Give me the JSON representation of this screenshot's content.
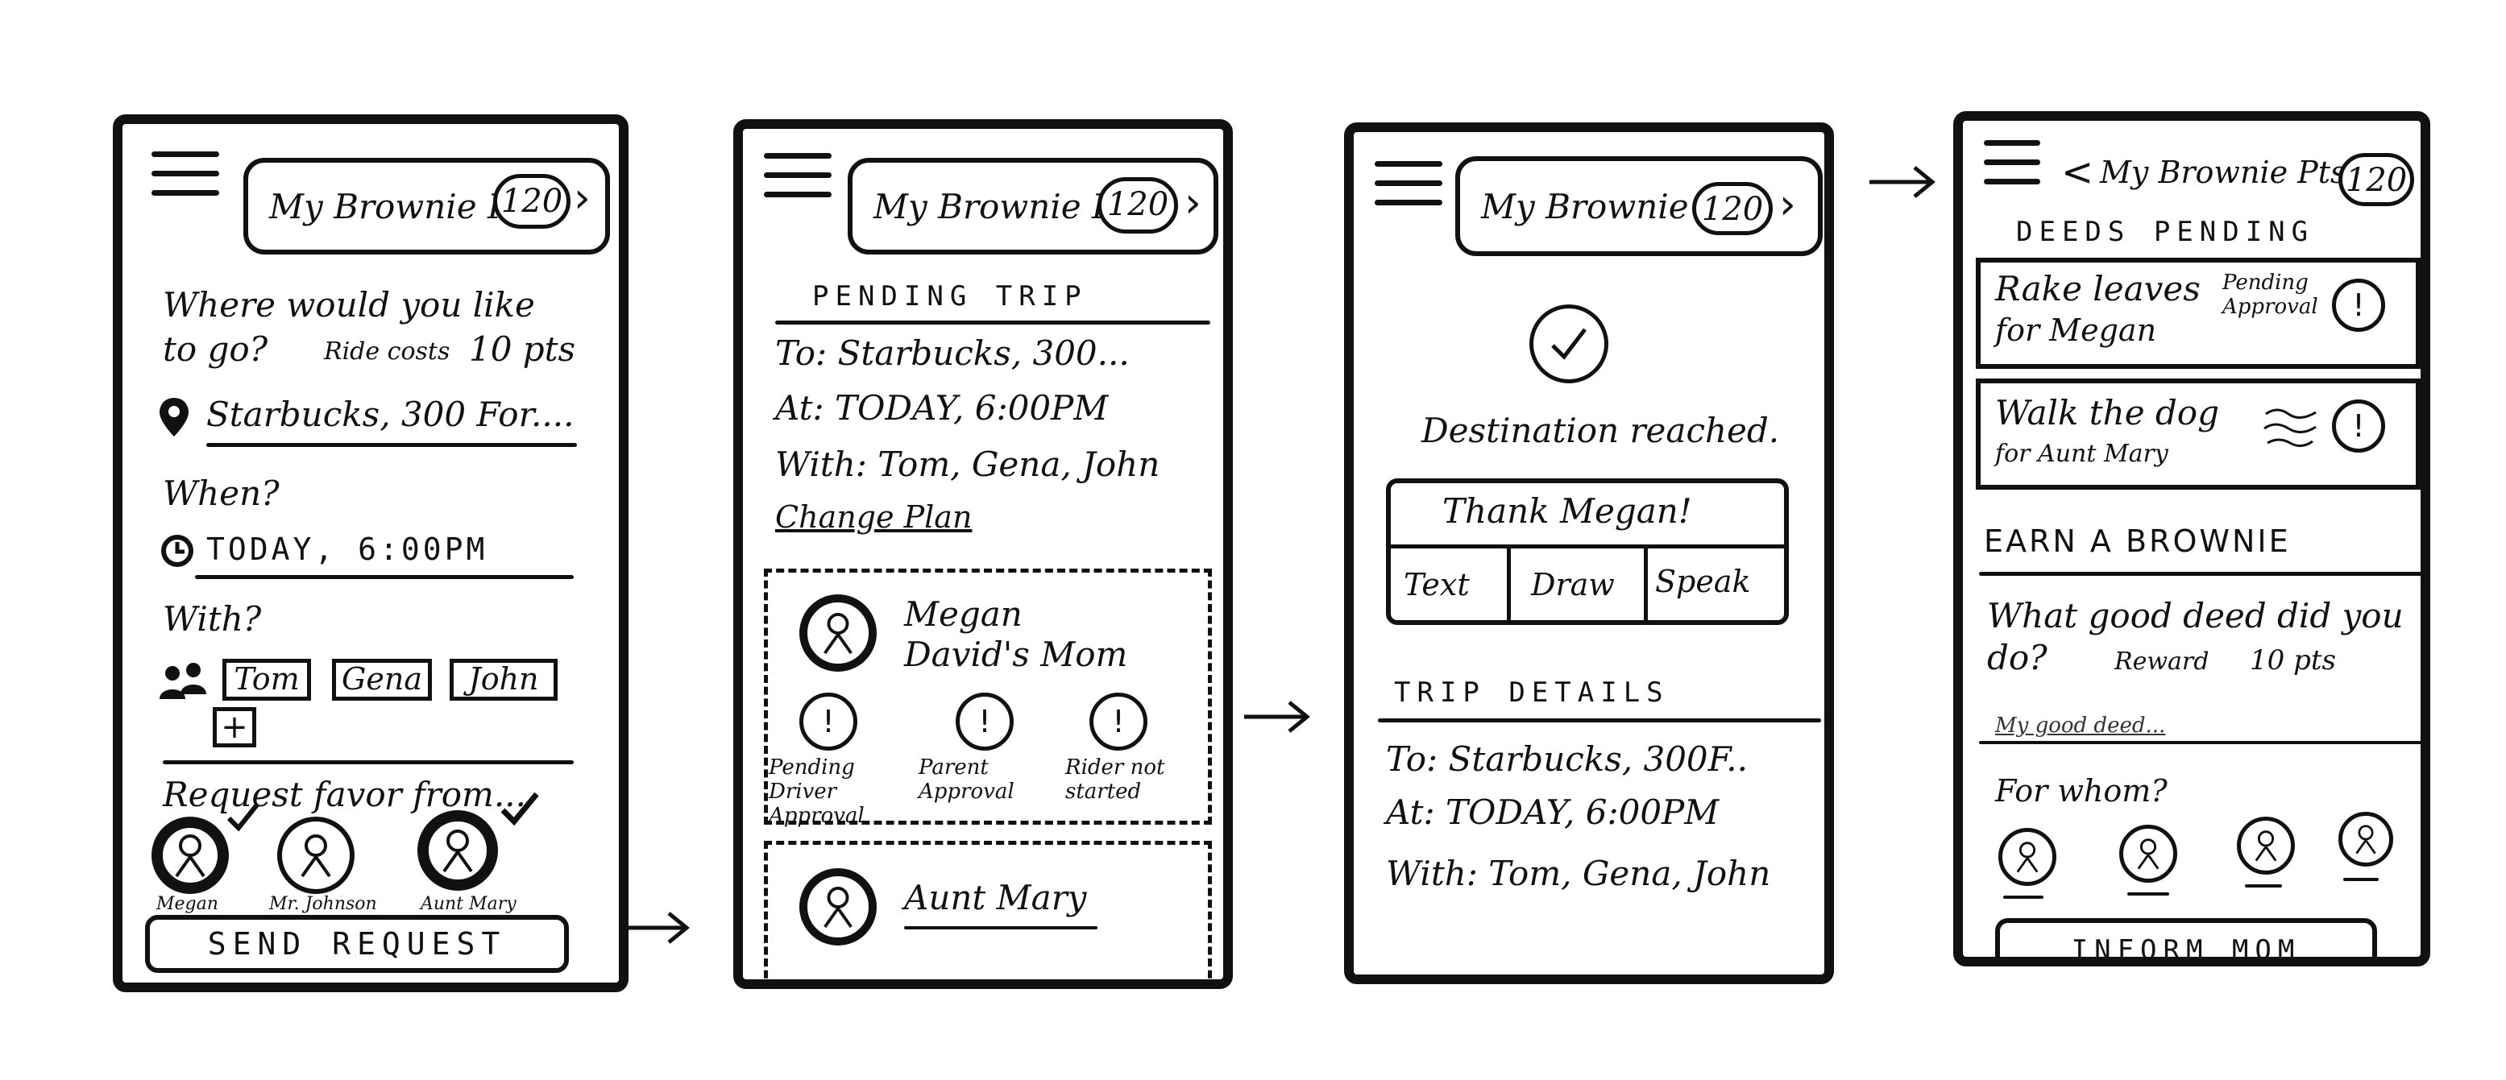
{
  "common": {
    "points_label": "My Brownie Pts",
    "points_value": "120"
  },
  "screen1": {
    "where_q": "Where would you like",
    "where_q2": "to go?",
    "ride_cost_label": "Ride costs",
    "ride_cost_value": "10 pts",
    "destination": "Starbucks, 300 For....",
    "when_label": "When?",
    "when_value": "TODAY, 6:00PM",
    "with_label": "With?",
    "companions": [
      "Tom",
      "Gena",
      "John"
    ],
    "add_label": "+",
    "request_label": "Request favor from...",
    "favor_people": [
      "Megan",
      "Mr. Johnson",
      "Aunt Mary"
    ],
    "send_button": "SEND REQUEST"
  },
  "screen2": {
    "section_title": "PENDING TRIP",
    "to_line": "To: Starbucks, 300...",
    "at_line": "At: TODAY, 6:00PM",
    "with_line": "With: Tom, Gena, John",
    "change_plan": "Change Plan",
    "driver_name": "Megan",
    "driver_relation": "David's Mom",
    "statuses": [
      "Pending Driver Approval",
      "Parent Approval",
      "Rider not started"
    ],
    "next_driver": "Aunt Mary"
  },
  "screen3": {
    "destination_msg": "Destination reached.",
    "thank_title": "Thank Megan!",
    "thank_options": [
      "Text",
      "Draw",
      "Speak"
    ],
    "trip_details_title": "TRIP DETAILS",
    "to_line": "To: Starbucks, 300F..",
    "at_line": "At: TODAY, 6:00PM",
    "with_line": "With: Tom, Gena, John"
  },
  "screen4": {
    "back_label": "<",
    "deeds_title": "DEEDS PENDING",
    "deeds": [
      {
        "title": "Rake leaves",
        "sub": "for Megan",
        "status": "Pending Approval"
      },
      {
        "title": "Walk the dog",
        "sub": "for Aunt Mary",
        "status": ""
      }
    ],
    "earn_title": "EARN A BROWNIE",
    "question": "What good deed did you",
    "question2": "do?",
    "reward_label": "Reward",
    "reward_value": "10 pts",
    "deed_placeholder": "My good deed...",
    "for_whom_label": "For whom?",
    "inform_button": "INFORM MOM"
  },
  "colors": {
    "ink": "#111111",
    "paper": "#ffffff"
  }
}
